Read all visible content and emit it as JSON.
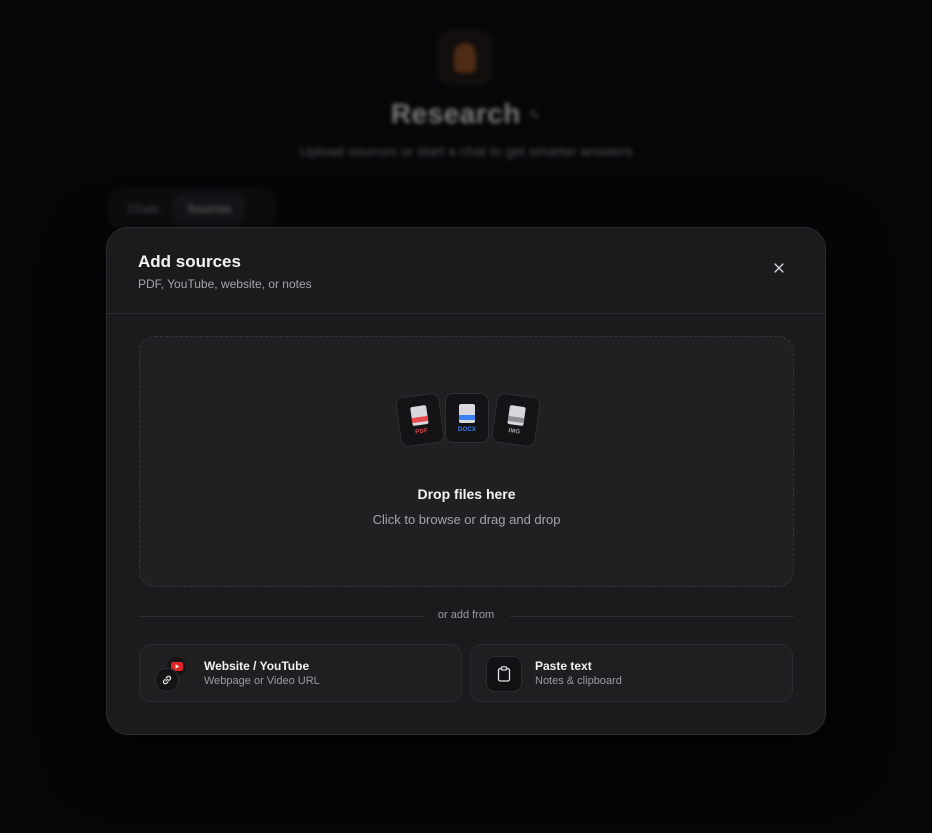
{
  "background": {
    "notebook_icon": "flame-icon",
    "title": "Research",
    "subtitle": "Upload sources or start a chat to get smarter answers",
    "tabs": [
      {
        "label": "Chats",
        "active": false
      },
      {
        "label": "Sources",
        "active": true
      }
    ]
  },
  "modal": {
    "title": "Add sources",
    "subtitle": "PDF, YouTube, website, or notes",
    "close_icon": "close-icon",
    "dropzone": {
      "title": "Drop files here",
      "subtitle": "Click to browse or drag and drop",
      "file_types": [
        {
          "label": "PDF",
          "color": "#e5484d"
        },
        {
          "label": "DOCX",
          "color": "#3b82f6"
        },
        {
          "label": "IMG",
          "color": "#a4a4ac"
        }
      ]
    },
    "divider_text": "or add from",
    "options": [
      {
        "title": "Website / YouTube",
        "subtitle": "Webpage or Video URL",
        "icons": [
          "youtube-icon",
          "link-icon"
        ]
      },
      {
        "title": "Paste text",
        "subtitle": "Notes & clipboard",
        "icons": [
          "clipboard-icon"
        ]
      }
    ]
  },
  "colors": {
    "backdrop": "#060608",
    "modal_bg": "#1b1b1e",
    "youtube_red": "#e02424",
    "pdf_red": "#e5484d",
    "docx_blue": "#3b82f6"
  }
}
